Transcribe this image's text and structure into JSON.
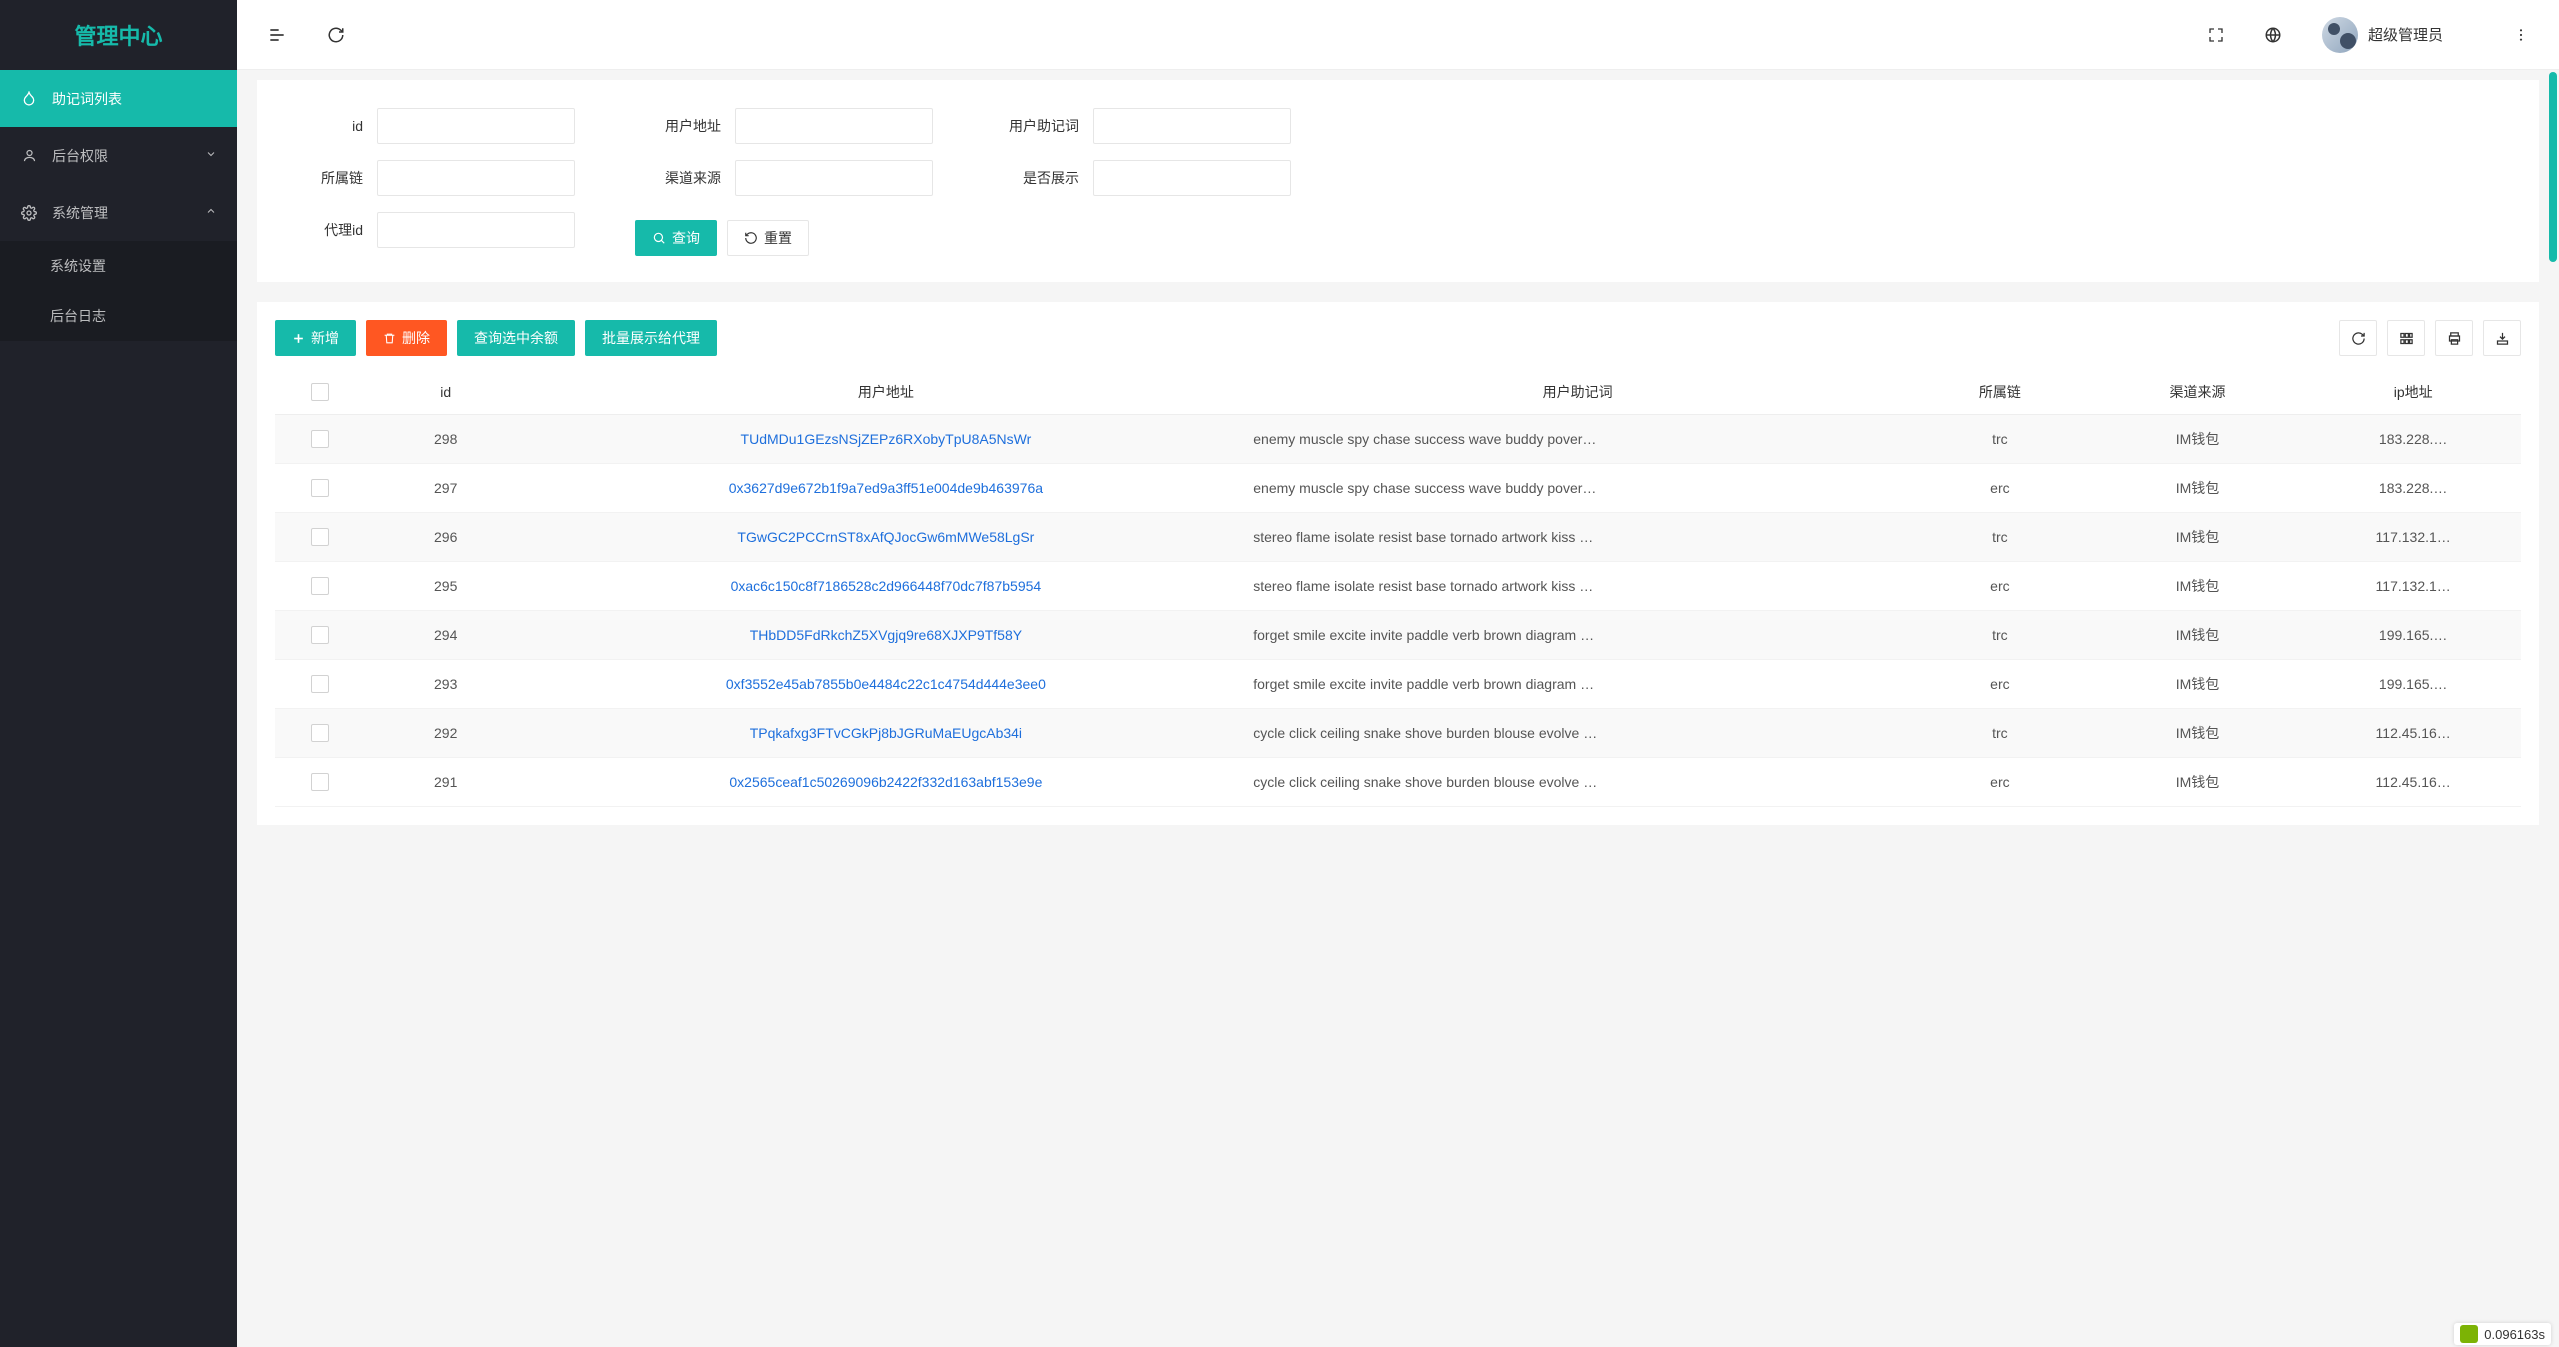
{
  "sidebar": {
    "logo": "管理中心",
    "items": [
      {
        "label": "助记词列表",
        "icon": "fire"
      },
      {
        "label": "后台权限",
        "icon": "user",
        "chevron": "down"
      },
      {
        "label": "系统管理",
        "icon": "gear",
        "chevron": "up"
      }
    ],
    "sub_items": [
      {
        "label": "系统设置"
      },
      {
        "label": "后台日志"
      }
    ]
  },
  "topbar": {
    "user_name": "超级管理员"
  },
  "search": {
    "labels": {
      "id": "id",
      "user_address": "用户地址",
      "user_mnemonic": "用户助记词",
      "chain": "所属链",
      "channel": "渠道来源",
      "is_show": "是否展示",
      "agent_id": "代理id"
    },
    "values": {
      "id": "",
      "user_address": "",
      "user_mnemonic": "",
      "chain": "",
      "channel": "",
      "is_show": "",
      "agent_id": ""
    },
    "buttons": {
      "query": "查询",
      "reset": "重置"
    }
  },
  "toolbar": {
    "add": "新增",
    "delete": "删除",
    "query_balance": "查询选中余额",
    "batch_show": "批量展示给代理"
  },
  "table": {
    "headers": {
      "id": "id",
      "user_address": "用户地址",
      "user_mnemonic": "用户助记词",
      "chain": "所属链",
      "channel": "渠道来源",
      "ip": "ip地址"
    },
    "rows": [
      {
        "id": "298",
        "user_address": "TUdMDu1GEzsNSjZEPz6RXobyTpU8A5NsWr",
        "user_mnemonic": "enemy muscle spy chase success wave buddy pover…",
        "chain": "trc",
        "channel": "IM钱包",
        "ip": "183.228.…"
      },
      {
        "id": "297",
        "user_address": "0x3627d9e672b1f9a7ed9a3ff51e004de9b463976a",
        "user_mnemonic": "enemy muscle spy chase success wave buddy pover…",
        "chain": "erc",
        "channel": "IM钱包",
        "ip": "183.228.…"
      },
      {
        "id": "296",
        "user_address": "TGwGC2PCCrnST8xAfQJocGw6mMWe58LgSr",
        "user_mnemonic": "stereo flame isolate resist base tornado artwork kiss …",
        "chain": "trc",
        "channel": "IM钱包",
        "ip": "117.132.1…"
      },
      {
        "id": "295",
        "user_address": "0xac6c150c8f7186528c2d966448f70dc7f87b5954",
        "user_mnemonic": "stereo flame isolate resist base tornado artwork kiss …",
        "chain": "erc",
        "channel": "IM钱包",
        "ip": "117.132.1…"
      },
      {
        "id": "294",
        "user_address": "THbDD5FdRkchZ5XVgjq9re68XJXP9Tf58Y",
        "user_mnemonic": "forget smile excite invite paddle verb brown diagram …",
        "chain": "trc",
        "channel": "IM钱包",
        "ip": "199.165.…"
      },
      {
        "id": "293",
        "user_address": "0xf3552e45ab7855b0e4484c22c1c4754d444e3ee0",
        "user_mnemonic": "forget smile excite invite paddle verb brown diagram …",
        "chain": "erc",
        "channel": "IM钱包",
        "ip": "199.165.…"
      },
      {
        "id": "292",
        "user_address": "TPqkafxg3FTvCGkPj8bJGRuMaEUgcAb34i",
        "user_mnemonic": "cycle click ceiling snake shove burden blouse evolve …",
        "chain": "trc",
        "channel": "IM钱包",
        "ip": "112.45.16…"
      },
      {
        "id": "291",
        "user_address": "0x2565ceaf1c50269096b2422f332d163abf153e9e",
        "user_mnemonic": "cycle click ceiling snake shove burden blouse evolve …",
        "chain": "erc",
        "channel": "IM钱包",
        "ip": "112.45.16…"
      }
    ]
  },
  "debug": {
    "time": "0.096163s"
  }
}
